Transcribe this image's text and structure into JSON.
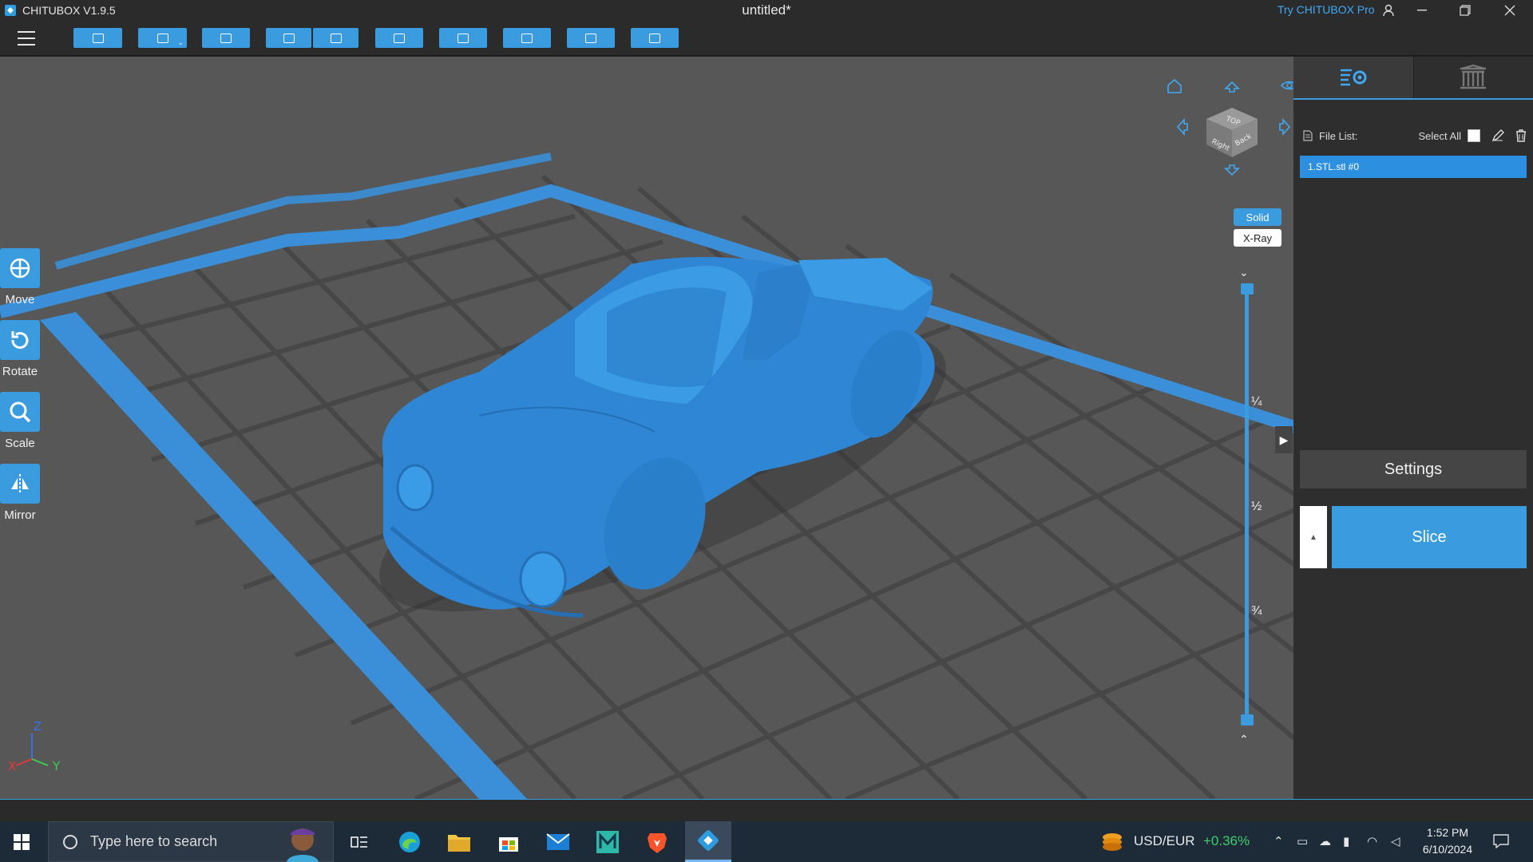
{
  "window": {
    "app_name": "CHITUBOX V1.9.5",
    "doc_title": "untitled*",
    "try_pro": "Try CHITUBOX Pro"
  },
  "toolbar": {
    "buttons": [
      "open-file",
      "save",
      "fit-view",
      "undo",
      "redo",
      "layout",
      "arrange",
      "support",
      "hollow",
      "dig-hole"
    ]
  },
  "left_tools": [
    {
      "id": "move",
      "label": "Move"
    },
    {
      "id": "rotate",
      "label": "Rotate"
    },
    {
      "id": "scale",
      "label": "Scale"
    },
    {
      "id": "mirror",
      "label": "Mirror"
    }
  ],
  "view_modes": {
    "solid": "Solid",
    "xray": "X-Ray",
    "active": "Solid"
  },
  "nav_cube": {
    "faces": [
      "TOP",
      "Right",
      "Back"
    ]
  },
  "layer_slider": {
    "marks": [
      "¼",
      "½",
      "¾"
    ]
  },
  "axis": {
    "x": "X",
    "y": "Y",
    "z": "Z"
  },
  "right_panel": {
    "file_list_label": "File List:",
    "select_all_label": "Select All",
    "files": [
      "1.STL.stl #0"
    ],
    "settings_label": "Settings",
    "slice_label": "Slice"
  },
  "taskbar": {
    "search_placeholder": "Type here to search",
    "ticker_name": "USD/EUR",
    "ticker_change": "+0.36%",
    "time": "1:52 PM",
    "date": "6/10/2024"
  },
  "colors": {
    "accent": "#3a9cde",
    "model": "#3b8fd6",
    "platform": "#575757",
    "grid_line": "#444444"
  }
}
